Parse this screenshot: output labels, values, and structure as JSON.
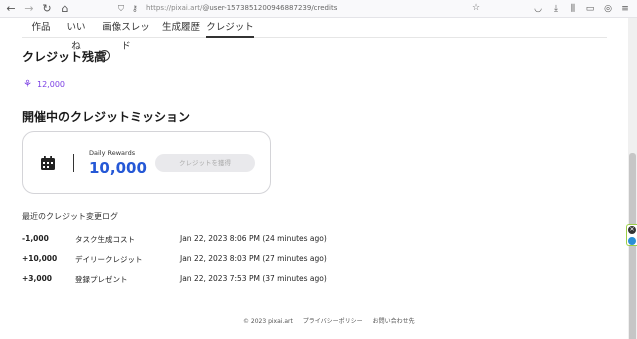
{
  "browser": {
    "url_prefix": "https://pixai.art/",
    "url_rest": "@user-1573851200946887239/credits"
  },
  "tabs": [
    {
      "label": "作品"
    },
    {
      "label": "いいね"
    },
    {
      "label": "画像スレッド"
    },
    {
      "label": "生成履歴"
    },
    {
      "label": "クレジット",
      "active": true
    }
  ],
  "credits": {
    "title": "クレジット残高",
    "balance": "12,000"
  },
  "mission": {
    "title": "開催中のクレジットミッション",
    "label": "Daily Rewards",
    "value": "10,000",
    "button": "クレジットを獲得"
  },
  "log": {
    "title": "最近のクレジット変更ログ",
    "rows": [
      {
        "amount": "-1,000",
        "desc": "タスク生成コスト",
        "time": "Jan 22, 2023 8:06 PM (24 minutes ago)"
      },
      {
        "amount": "+10,000",
        "desc": "デイリークレジット",
        "time": "Jan 22, 2023 8:03 PM (27 minutes ago)"
      },
      {
        "amount": "+3,000",
        "desc": "登録プレゼント",
        "time": "Jan 22, 2023 7:53 PM (37 minutes ago)"
      }
    ]
  },
  "footer": {
    "copyright": "© 2023 pixai.art",
    "privacy": "プライバシーポリシー",
    "contact": "お問い合わせ先"
  },
  "colors": {
    "accent_purple": "#7b3fe4",
    "value_blue": "#2558d6"
  }
}
